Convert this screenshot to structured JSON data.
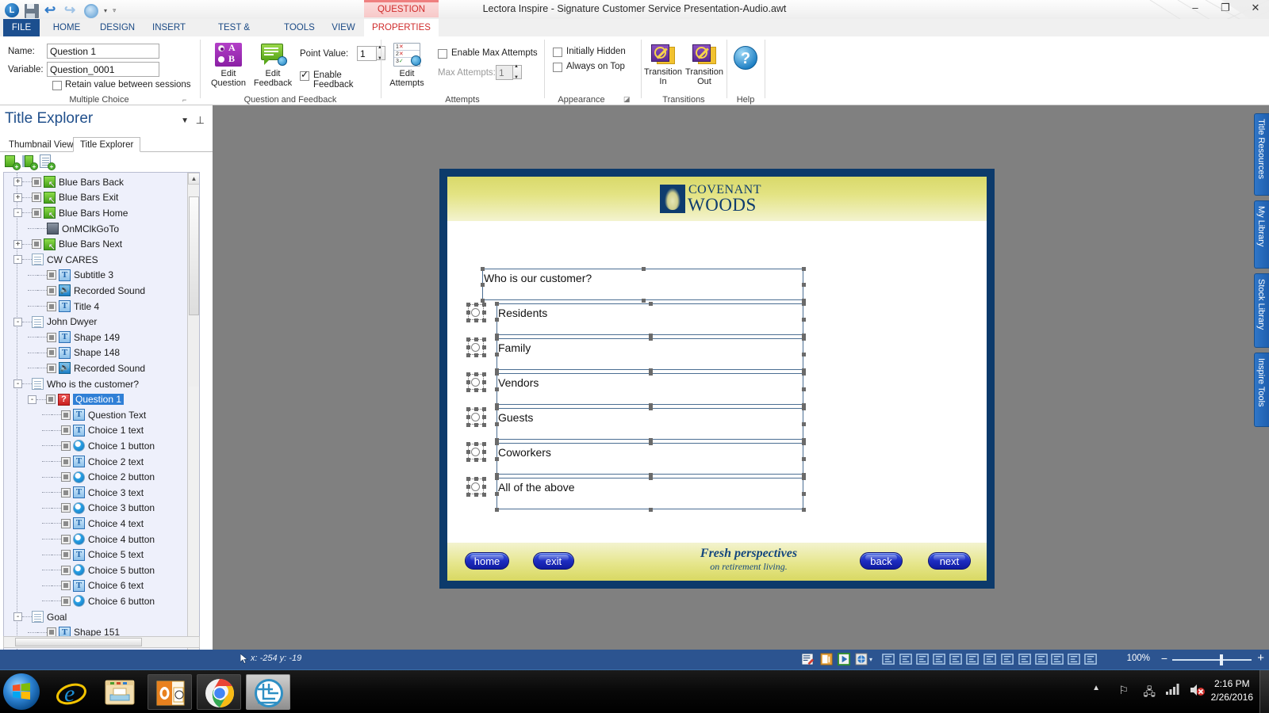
{
  "window": {
    "title": "Lectora Inspire - Signature Customer Service Presentation-Audio.awt",
    "minimize": "–",
    "restore": "❐",
    "close": "✕",
    "help_glyph": "?",
    "quick_access": [
      "lectora-logo",
      "save-icon",
      "undo-icon",
      "redo-icon",
      "preview-icon",
      "dropdown-caret"
    ]
  },
  "ribbon": {
    "context_tab": "QUESTION",
    "tabs": [
      {
        "label": "FILE"
      },
      {
        "label": "HOME"
      },
      {
        "label": "DESIGN"
      },
      {
        "label": "INSERT"
      },
      {
        "label": "TEST & SURVEY"
      },
      {
        "label": "TOOLS"
      },
      {
        "label": "VIEW"
      },
      {
        "label": "PROPERTIES"
      }
    ],
    "groups": {
      "multiple_choice": {
        "label": "Multiple Choice",
        "name_label": "Name:",
        "name_value": "Question 1",
        "variable_label": "Variable:",
        "variable_value": "Question_0001",
        "retain_label": "Retain value between sessions",
        "retain_checked": false,
        "dialog_launcher": "⌐"
      },
      "question_feedback": {
        "label": "Question and Feedback",
        "edit_question": "Edit\nQuestion",
        "edit_question_line1": "Edit",
        "edit_question_line2": "Question",
        "edit_feedback_line1": "Edit",
        "edit_feedback_line2": "Feedback",
        "point_value_label": "Point Value:",
        "point_value": "1",
        "enable_feedback_label": "Enable Feedback",
        "enable_feedback_checked": true
      },
      "attempts": {
        "label": "Attempts",
        "edit_attempts_line1": "Edit",
        "edit_attempts_line2": "Attempts",
        "enable_max_attempts_label": "Enable Max Attempts",
        "enable_max_attempts_checked": false,
        "max_attempts_label": "Max Attempts:",
        "max_attempts_value": "1"
      },
      "appearance": {
        "label": "Appearance",
        "initially_hidden_label": "Initially Hidden",
        "initially_hidden_checked": false,
        "always_on_top_label": "Always on Top",
        "always_on_top_checked": false,
        "dialog_launcher": "⌐"
      },
      "transitions": {
        "label": "Transitions",
        "transition_in_line1": "Transition",
        "transition_in_line2": "In",
        "transition_out_line1": "Transition",
        "transition_out_line2": "Out"
      },
      "help": {
        "label": "Help",
        "glyph": "?"
      }
    }
  },
  "left_panel": {
    "title": "Title Explorer",
    "dropdown_glyph": "▼",
    "pin_glyph": "⇱",
    "tabs": [
      {
        "label": "Thumbnail View",
        "selected": false
      },
      {
        "label": "Title Explorer",
        "selected": true
      }
    ],
    "toolbar_icons": [
      "add-chapter-icon",
      "add-section-icon",
      "add-page-icon"
    ],
    "tree": [
      {
        "label": "Blue Bars Back",
        "indent": 1,
        "expander": "+",
        "icon": "group",
        "checkbox": true
      },
      {
        "label": "Blue Bars Exit",
        "indent": 1,
        "expander": "+",
        "icon": "group",
        "checkbox": true
      },
      {
        "label": "Blue Bars Home",
        "indent": 1,
        "expander": "-",
        "icon": "group",
        "checkbox": true
      },
      {
        "label": "OnMClkGoTo",
        "indent": 2,
        "expander": "",
        "icon": "action",
        "checkbox": false
      },
      {
        "label": "Blue Bars Next",
        "indent": 1,
        "expander": "+",
        "icon": "group",
        "checkbox": true
      },
      {
        "label": "CW CARES",
        "indent": 1,
        "expander": "-",
        "icon": "page",
        "checkbox": false
      },
      {
        "label": "Subtitle 3",
        "indent": 2,
        "expander": "",
        "icon": "text",
        "checkbox": true
      },
      {
        "label": "Recorded Sound",
        "indent": 2,
        "expander": "",
        "icon": "sound",
        "checkbox": true
      },
      {
        "label": "Title 4",
        "indent": 2,
        "expander": "",
        "icon": "text",
        "checkbox": true
      },
      {
        "label": "John Dwyer",
        "indent": 1,
        "expander": "-",
        "icon": "page",
        "checkbox": false
      },
      {
        "label": "Shape 149",
        "indent": 2,
        "expander": "",
        "icon": "text",
        "checkbox": true
      },
      {
        "label": "Shape 148",
        "indent": 2,
        "expander": "",
        "icon": "text",
        "checkbox": true
      },
      {
        "label": "Recorded Sound",
        "indent": 2,
        "expander": "",
        "icon": "sound",
        "checkbox": true
      },
      {
        "label": "Who is the customer?",
        "indent": 1,
        "expander": "-",
        "icon": "page",
        "checkbox": false
      },
      {
        "label": "Question 1",
        "indent": 2,
        "expander": "-",
        "icon": "question",
        "checkbox": true,
        "selected": true
      },
      {
        "label": "Question Text",
        "indent": 3,
        "expander": "",
        "icon": "text",
        "checkbox": true
      },
      {
        "label": "Choice 1 text",
        "indent": 3,
        "expander": "",
        "icon": "text",
        "checkbox": true
      },
      {
        "label": "Choice 1 button",
        "indent": 3,
        "expander": "",
        "icon": "radio",
        "checkbox": true
      },
      {
        "label": "Choice 2 text",
        "indent": 3,
        "expander": "",
        "icon": "text",
        "checkbox": true
      },
      {
        "label": "Choice 2 button",
        "indent": 3,
        "expander": "",
        "icon": "radio",
        "checkbox": true
      },
      {
        "label": "Choice 3 text",
        "indent": 3,
        "expander": "",
        "icon": "text",
        "checkbox": true
      },
      {
        "label": "Choice 3 button",
        "indent": 3,
        "expander": "",
        "icon": "radio",
        "checkbox": true
      },
      {
        "label": "Choice 4 text",
        "indent": 3,
        "expander": "",
        "icon": "text",
        "checkbox": true
      },
      {
        "label": "Choice 4 button",
        "indent": 3,
        "expander": "",
        "icon": "radio",
        "checkbox": true
      },
      {
        "label": "Choice 5 text",
        "indent": 3,
        "expander": "",
        "icon": "text",
        "checkbox": true
      },
      {
        "label": "Choice 5 button",
        "indent": 3,
        "expander": "",
        "icon": "radio",
        "checkbox": true
      },
      {
        "label": "Choice 6 text",
        "indent": 3,
        "expander": "",
        "icon": "text",
        "checkbox": true
      },
      {
        "label": "Choice 6 button",
        "indent": 3,
        "expander": "",
        "icon": "radio",
        "checkbox": true
      },
      {
        "label": "Goal",
        "indent": 1,
        "expander": "-",
        "icon": "page",
        "checkbox": false
      },
      {
        "label": "Shape 151",
        "indent": 2,
        "expander": "",
        "icon": "text",
        "checkbox": true
      }
    ],
    "scroll_up": "▲",
    "scroll_down": "▼"
  },
  "slide": {
    "logo_line1": "COVENANT",
    "logo_line2": "WOODS",
    "question_text": "Who is our customer?",
    "choices": [
      "Residents",
      "Family",
      "Vendors",
      "Guests",
      "Coworkers",
      "All of the above"
    ],
    "tagline_line1": "Fresh perspectives",
    "tagline_line2": "on retirement living.",
    "nav_buttons": [
      {
        "label": "home"
      },
      {
        "label": "exit"
      },
      {
        "label": "back"
      },
      {
        "label": "next"
      }
    ]
  },
  "right_tabs": [
    {
      "label": "Title Resources"
    },
    {
      "label": "My Library"
    },
    {
      "label": "Stock Library"
    },
    {
      "label": "Inspire Tools"
    }
  ],
  "status_bar": {
    "cursor_glyph": "➤",
    "coords": "x: -254  y: -19",
    "zoom": "100%",
    "minus": "−",
    "plus": "+",
    "icons": [
      "edit-mode-icon",
      "run-mode-icon",
      "preview-page-icon",
      "preview-browser-icon",
      "preview-caret",
      "align-left-icon",
      "align-center-h-icon",
      "align-right-icon",
      "align-top-icon",
      "align-middle-icon",
      "align-bottom-icon",
      "size-width-icon",
      "size-height-icon",
      "size-both-icon",
      "distribute-h-icon",
      "distribute-v-icon",
      "group-left-icon",
      "group-right-icon"
    ]
  },
  "taskbar": {
    "start_label": "start-orb",
    "items": [
      {
        "name": "internet-explorer-icon"
      },
      {
        "name": "file-explorer-icon"
      },
      {
        "name": "outlook-icon"
      },
      {
        "name": "chrome-icon"
      },
      {
        "name": "lectora-icon"
      }
    ],
    "tray_icons": [
      "show-hidden-icons-caret",
      "flag-action-center-icon",
      "network-icon",
      "signal-icon",
      "volume-muted-icon"
    ],
    "time": "2:16 PM",
    "date": "2/26/2016"
  }
}
